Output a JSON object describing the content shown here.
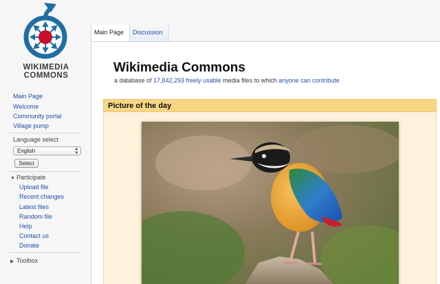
{
  "logo": {
    "line1": "WIKIMEDIA",
    "line2": "COMMONS",
    "icon": "wikimedia-commons-logo",
    "colors": {
      "blue": "#1f6ea3",
      "red": "#c8102e"
    }
  },
  "sidebar": {
    "nav": [
      {
        "label": "Main Page"
      },
      {
        "label": "Welcome"
      },
      {
        "label": "Community portal"
      },
      {
        "label": "Village pump"
      }
    ],
    "language": {
      "heading": "Language select",
      "selected": "English",
      "button": "Select"
    },
    "participate": {
      "heading": "Participate",
      "items": [
        {
          "label": "Upload file"
        },
        {
          "label": "Recent changes"
        },
        {
          "label": "Latest files"
        },
        {
          "label": "Random file"
        },
        {
          "label": "Help"
        },
        {
          "label": "Contact us"
        },
        {
          "label": "Donate"
        }
      ]
    },
    "toolbox": {
      "heading": "Toolbox"
    }
  },
  "tabs": [
    {
      "label": "Main Page",
      "active": true
    },
    {
      "label": "Discussion",
      "active": false
    }
  ],
  "main": {
    "title": "Wikimedia Commons",
    "tagline": {
      "prefix": "a database of ",
      "count": "17,842,293",
      "space1": " ",
      "freely": "freely",
      "space2": " ",
      "usable": "usable",
      "middle": " media files to which ",
      "anyone": "anyone can contribute"
    },
    "potd": {
      "heading": "Picture of the day",
      "image_subject": "blue-winged-pitta-bird-photo"
    }
  },
  "colors": {
    "link": "#1f4fa8",
    "potd_header_bg": "#f7d685",
    "potd_box_bg": "#fdf3dc"
  }
}
